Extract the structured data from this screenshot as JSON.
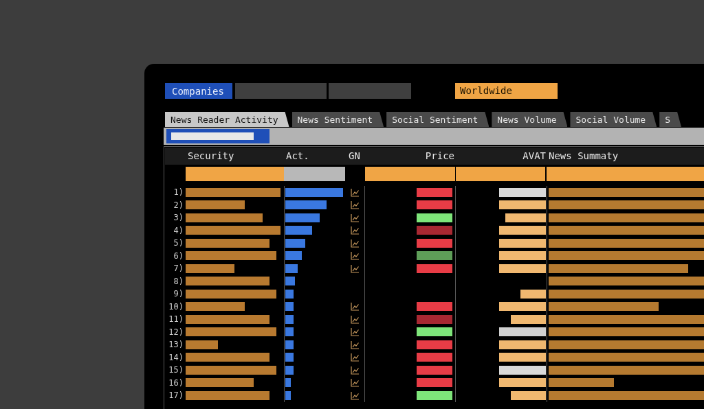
{
  "toolbar": {
    "scope_button": "Companies",
    "region_field": "Worldwide"
  },
  "tabs": [
    {
      "label": "News Reader Activity",
      "selected": true
    },
    {
      "label": "News Sentiment",
      "selected": false
    },
    {
      "label": "Social Sentiment",
      "selected": false
    },
    {
      "label": "News Volume",
      "selected": false
    },
    {
      "label": "Social Volume",
      "selected": false
    },
    {
      "label": "S",
      "selected": false
    }
  ],
  "table": {
    "columns": [
      "Security",
      "Act.",
      "GN",
      "Price",
      "AVAT",
      "News Summaty"
    ],
    "rows": [
      {
        "number": "1)",
        "activity": {
          "level": 1
        },
        "gn_chart": true,
        "price": {
          "color": "#e83c46"
        },
        "avat": {
          "color": "#d9d9d9"
        },
        "news": {
          "level": 1
        }
      },
      {
        "number": "2)",
        "activity": {
          "level": 0.72
        },
        "gn_chart": true,
        "price": {
          "color": "#e83c46"
        },
        "avat": {
          "color": "#f0b870"
        },
        "news": {
          "level": 1
        }
      },
      {
        "number": "3)",
        "activity": {
          "level": 0.59
        },
        "gn_chart": true,
        "price": {
          "color": "#7ee57a"
        },
        "avat": {
          "color": "#f0b870"
        },
        "news": {
          "level": 1
        }
      },
      {
        "number": "4)",
        "activity": {
          "level": 0.47
        },
        "gn_chart": true,
        "price": {
          "color": "#a82832"
        },
        "avat": {
          "color": "#f0b870"
        },
        "news": {
          "level": 1
        }
      },
      {
        "number": "5)",
        "activity": {
          "level": 0.35
        },
        "gn_chart": true,
        "price": {
          "color": "#e83c46"
        },
        "avat": {
          "color": "#f0b870"
        },
        "news": {
          "level": 1
        }
      },
      {
        "number": "6)",
        "activity": {
          "level": 0.28
        },
        "gn_chart": true,
        "price": {
          "color": "#5e9e58"
        },
        "avat": {
          "color": "#f0b870"
        },
        "news": {
          "level": 1
        }
      },
      {
        "number": "7)",
        "activity": {
          "level": 0.22
        },
        "gn_chart": true,
        "price": {
          "color": "#e83c46"
        },
        "avat": {
          "color": "#f0b870"
        },
        "news": {
          "level": 0.9
        }
      },
      {
        "number": "8)",
        "activity": {
          "level": 0.17
        },
        "gn_chart": false,
        "news": {
          "level": 1
        }
      },
      {
        "number": "9)",
        "activity": {
          "level": 0.14
        },
        "gn_chart": false,
        "avat": {
          "color": "#f0b870"
        },
        "news": {
          "level": 1
        }
      },
      {
        "number": "10)",
        "activity": {
          "level": 0.14
        },
        "gn_chart": true,
        "price": {
          "color": "#e83c46"
        },
        "avat": {
          "color": "#f0b870"
        },
        "news": {
          "level": 0.71
        }
      },
      {
        "number": "11)",
        "activity": {
          "level": 0.14
        },
        "gn_chart": true,
        "price": {
          "color": "#a82832"
        },
        "avat": {
          "color": "#f0b870"
        },
        "news": {
          "level": 1
        }
      },
      {
        "number": "12)",
        "activity": {
          "level": 0.14
        },
        "gn_chart": true,
        "price": {
          "color": "#7ee57a"
        },
        "avat": {
          "color": "#d0d0d0"
        },
        "news": {
          "level": 1
        }
      },
      {
        "number": "13)",
        "activity": {
          "level": 0.14
        },
        "gn_chart": true,
        "price": {
          "color": "#e83c46"
        },
        "avat": {
          "color": "#f0b870"
        },
        "news": {
          "level": 1
        }
      },
      {
        "number": "14)",
        "activity": {
          "level": 0.14
        },
        "gn_chart": true,
        "price": {
          "color": "#e83c46"
        },
        "avat": {
          "color": "#f0b870"
        },
        "news": {
          "level": 1
        }
      },
      {
        "number": "15)",
        "activity": {
          "level": 0.14
        },
        "gn_chart": true,
        "price": {
          "color": "#e83c46"
        },
        "avat": {
          "color": "#d9d9d9"
        },
        "news": {
          "level": 1
        }
      },
      {
        "number": "16)",
        "activity": {
          "level": 0.1
        },
        "gn_chart": true,
        "price": {
          "color": "#e83c46"
        },
        "avat": {
          "color": "#f0b870"
        },
        "news": {
          "level": 0.42
        }
      },
      {
        "number": "17)",
        "activity": {
          "level": 0.1
        },
        "gn_chart": true,
        "price": {
          "color": "#7ee57a"
        },
        "avat": {
          "color": "#f0b870"
        },
        "news": {
          "level": 1
        }
      }
    ]
  }
}
